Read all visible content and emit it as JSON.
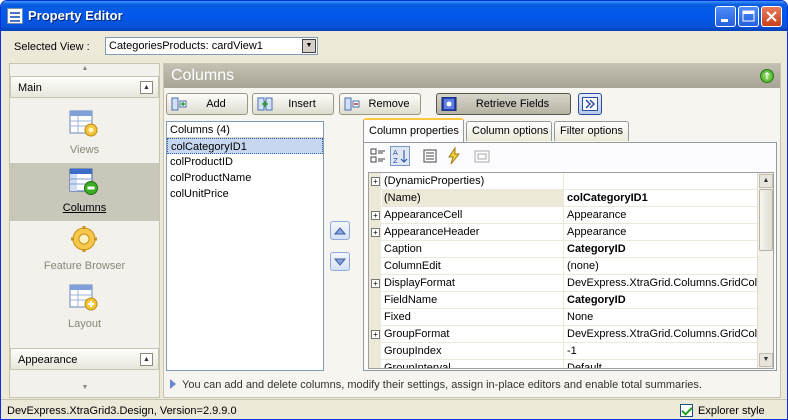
{
  "window": {
    "title": "Property Editor"
  },
  "selected_view": {
    "label": "Selected View :",
    "value": "CategoriesProducts: cardView1"
  },
  "nav": {
    "groups": [
      {
        "title": "Main"
      },
      {
        "title": "Appearance"
      }
    ],
    "items": [
      {
        "label": "Views"
      },
      {
        "label": "Columns"
      },
      {
        "label": "Feature Browser"
      },
      {
        "label": "Layout"
      }
    ]
  },
  "main": {
    "title": "Columns",
    "buttons": {
      "add": "Add",
      "insert": "Insert",
      "remove": "Remove",
      "retrieve": "Retrieve Fields"
    },
    "columns_list": {
      "header": "Columns (4)",
      "items": [
        "colCategoryID1",
        "colProductID",
        "colProductName",
        "colUnitPrice"
      ]
    },
    "tabs": [
      "Column properties",
      "Column options",
      "Filter options"
    ],
    "properties": [
      {
        "name": "(DynamicProperties)",
        "value": "",
        "expandable": true
      },
      {
        "name": "(Name)",
        "value": "colCategoryID1",
        "bold": true
      },
      {
        "name": "AppearanceCell",
        "value": "Appearance",
        "expandable": true
      },
      {
        "name": "AppearanceHeader",
        "value": "Appearance",
        "expandable": true
      },
      {
        "name": "Caption",
        "value": "CategoryID",
        "bold": true
      },
      {
        "name": "ColumnEdit",
        "value": "(none)"
      },
      {
        "name": "DisplayFormat",
        "value": "DevExpress.XtraGrid.Columns.GridColun",
        "expandable": true
      },
      {
        "name": "FieldName",
        "value": "CategoryID",
        "bold": true
      },
      {
        "name": "Fixed",
        "value": "None"
      },
      {
        "name": "GroupFormat",
        "value": "DevExpress.XtraGrid.Columns.GridColun",
        "expandable": true
      },
      {
        "name": "GroupIndex",
        "value": "-1"
      },
      {
        "name": "GroupInterval",
        "value": "Default"
      }
    ],
    "hint": "You can add and delete columns, modify their settings, assign in-place editors and enable total summaries."
  },
  "status": {
    "text": "DevExpress.XtraGrid3.Design, Version=2.9.9.0",
    "explorer_style_label": "Explorer style"
  }
}
